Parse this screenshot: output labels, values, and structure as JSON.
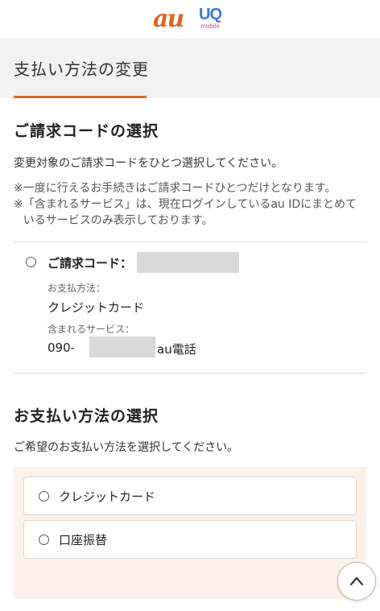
{
  "header": {
    "logo_au": "au",
    "logo_uq": "UQ",
    "logo_uq_sub": "mobile"
  },
  "page": {
    "title": "支払い方法の変更"
  },
  "billing_section": {
    "heading": "ご請求コードの選択",
    "description": "変更対象のご請求コードをひとつ選択してください。",
    "notes": [
      {
        "mark": "※",
        "text": "一度に行えるお手続きはご請求コードひとつだけとなります。"
      },
      {
        "mark": "※",
        "text": "「含まれるサービス」は、現在ログインしているau IDにまとめているサービスのみ表示しております。"
      }
    ],
    "item": {
      "code_label": "ご請求コード：",
      "payment_method_label": "お支払方法：",
      "payment_method_value": "クレジットカード",
      "services_label": "含まれるサービス：",
      "phone_prefix": "090-",
      "phone_suffix": "au電話"
    }
  },
  "payment_section": {
    "heading": "お支払い方法の選択",
    "description": "ご希望のお支払い方法を選択してください。",
    "options": [
      {
        "label": "クレジットカード"
      },
      {
        "label": "口座振替"
      }
    ]
  },
  "icons": {
    "scroll_top": "chevron-up-icon"
  },
  "colors": {
    "accent": "#e0622a",
    "pay_box_bg": "#fdf1ec"
  }
}
